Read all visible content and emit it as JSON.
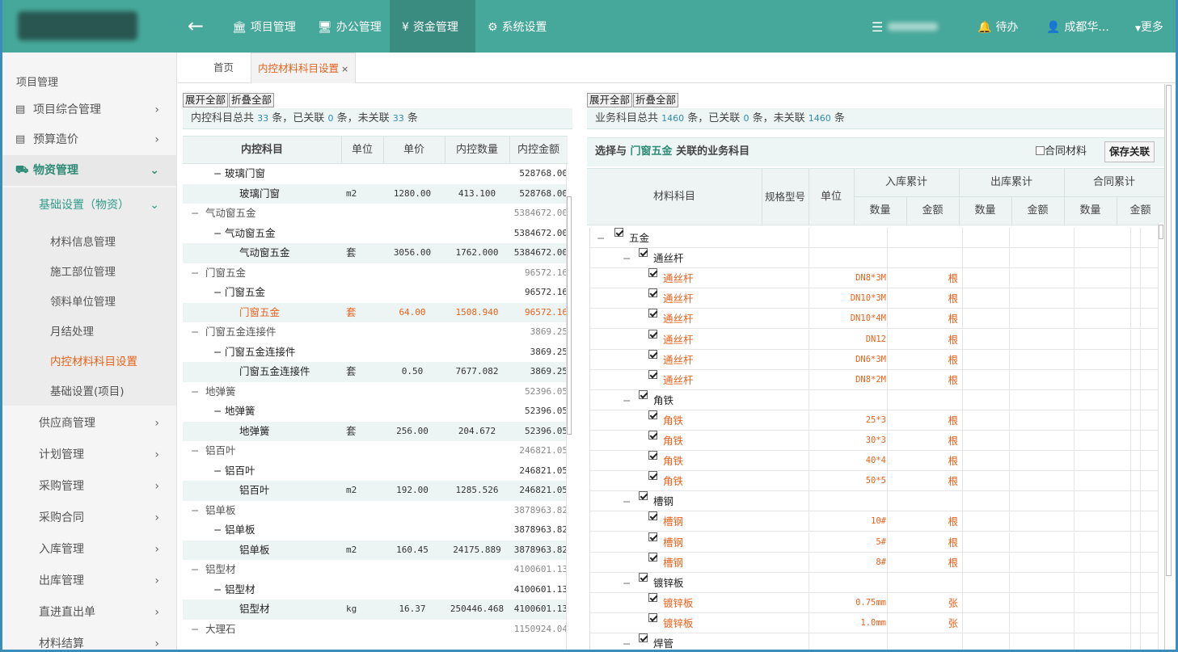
{
  "nav": {
    "back_icon": "arrow-left-icon",
    "project": "项目管理",
    "office": "办公管理",
    "finance": "资金管理",
    "finance_icon": "¥",
    "settings": "系统设置",
    "todo": "待办",
    "user": "成都华...",
    "more": "更多"
  },
  "sidebar": {
    "title": "项目管理",
    "items": [
      {
        "label": "项目综合管理"
      },
      {
        "label": "预算造价"
      },
      {
        "label": "物资管理"
      }
    ],
    "basic": "基础设置（物资）",
    "subitems": [
      "材料信息管理",
      "施工部位管理",
      "领料单位管理",
      "月结处理",
      "内控材料科目设置",
      "基础设置(项目)"
    ],
    "more_items": [
      "供应商管理",
      "计划管理",
      "采购管理",
      "采购合同",
      "入库管理",
      "出库管理",
      "直进直出单",
      "材料结算"
    ]
  },
  "tabs": {
    "home": "首页",
    "current": "内控材料科目设置",
    "close": "×"
  },
  "left": {
    "expand": "展开全部",
    "collapse": "折叠全部",
    "summary_a": "内控科目总共",
    "total": "33",
    "summary_b": "条，已关联",
    "linked": "0",
    "summary_c": "条，未关联",
    "unlinked": "33",
    "summary_d": "条",
    "headers": [
      "内控科目",
      "单位",
      "单价",
      "内控数量",
      "内控金额"
    ],
    "rows": [
      {
        "lvl": 2,
        "name": "玻璃门窗",
        "amount": "528768.00"
      },
      {
        "lvl": 3,
        "name": "玻璃门窗",
        "unit": "m2",
        "price": "1280.00",
        "qty": "413.100",
        "amount": "528768.00"
      },
      {
        "lvl": 1,
        "name": "气动窗五金",
        "amount": "5384672.00"
      },
      {
        "lvl": 2,
        "name": "气动窗五金",
        "amount": "5384672.00"
      },
      {
        "lvl": 3,
        "name": "气动窗五金",
        "unit": "套",
        "price": "3056.00",
        "qty": "1762.000",
        "amount": "5384672.00"
      },
      {
        "lvl": 1,
        "name": "门窗五金",
        "amount": "96572.16"
      },
      {
        "lvl": 2,
        "name": "门窗五金",
        "amount": "96572.16"
      },
      {
        "lvl": 3,
        "name": "门窗五金",
        "unit": "套",
        "price": "64.00",
        "qty": "1508.940",
        "amount": "96572.16",
        "selected": true
      },
      {
        "lvl": 1,
        "name": "门窗五金连接件",
        "amount": "3869.25"
      },
      {
        "lvl": 2,
        "name": "门窗五金连接件",
        "amount": "3869.25"
      },
      {
        "lvl": 3,
        "name": "门窗五金连接件",
        "unit": "套",
        "price": "0.50",
        "qty": "7677.082",
        "amount": "3869.25"
      },
      {
        "lvl": 1,
        "name": "地弹簧",
        "amount": "52396.05"
      },
      {
        "lvl": 2,
        "name": "地弹簧",
        "amount": "52396.05"
      },
      {
        "lvl": 3,
        "name": "地弹簧",
        "unit": "套",
        "price": "256.00",
        "qty": "204.672",
        "amount": "52396.05"
      },
      {
        "lvl": 1,
        "name": "铝百叶",
        "amount": "246821.05"
      },
      {
        "lvl": 2,
        "name": "铝百叶",
        "amount": "246821.05"
      },
      {
        "lvl": 3,
        "name": "铝百叶",
        "unit": "m2",
        "price": "192.00",
        "qty": "1285.526",
        "amount": "246821.05"
      },
      {
        "lvl": 1,
        "name": "铝单板",
        "amount": "3878963.82"
      },
      {
        "lvl": 2,
        "name": "铝单板",
        "amount": "3878963.82"
      },
      {
        "lvl": 3,
        "name": "铝单板",
        "unit": "m2",
        "price": "160.45",
        "qty": "24175.889",
        "amount": "3878963.82"
      },
      {
        "lvl": 1,
        "name": "铝型材",
        "amount": "4100601.13"
      },
      {
        "lvl": 2,
        "name": "铝型材",
        "amount": "4100601.13"
      },
      {
        "lvl": 3,
        "name": "铝型材",
        "unit": "kg",
        "price": "16.37",
        "qty": "250446.468",
        "amount": "4100601.13"
      },
      {
        "lvl": 1,
        "name": "大理石",
        "amount": "1150924.04"
      }
    ]
  },
  "right": {
    "expand": "展开全部",
    "collapse": "折叠全部",
    "summary_a": "业务科目总共",
    "total": "1460",
    "summary_b": "条，已关联",
    "linked": "0",
    "summary_c": "条，未关联",
    "unlinked": "1460",
    "summary_d": "条",
    "title_a": "选择与",
    "title_subject": "门窗五金",
    "title_b": "关联的业务科目",
    "contract_label": "合同材料",
    "save": "保存关联",
    "headers": {
      "material": "材料科目",
      "spec": "规格型号",
      "unit": "单位",
      "in": "入库累计",
      "out": "出库累计",
      "contract": "合同累计",
      "qty": "数量",
      "amount": "金额"
    },
    "rows": [
      {
        "lvl": 1,
        "name": "五金"
      },
      {
        "lvl": 2,
        "name": "通丝杆"
      },
      {
        "lvl": 3,
        "name": "通丝杆",
        "spec": "DN8*3M",
        "unit": "根"
      },
      {
        "lvl": 3,
        "name": "通丝杆",
        "spec": "DN10*3M",
        "unit": "根"
      },
      {
        "lvl": 3,
        "name": "通丝杆",
        "spec": "DN10*4M",
        "unit": "根"
      },
      {
        "lvl": 3,
        "name": "通丝杆",
        "spec": "DN12",
        "unit": "根"
      },
      {
        "lvl": 3,
        "name": "通丝杆",
        "spec": "DN6*3M",
        "unit": "根"
      },
      {
        "lvl": 3,
        "name": "通丝杆",
        "spec": "DN8*2M",
        "unit": "根"
      },
      {
        "lvl": 2,
        "name": "角铁"
      },
      {
        "lvl": 3,
        "name": "角铁",
        "spec": "25*3",
        "unit": "根"
      },
      {
        "lvl": 3,
        "name": "角铁",
        "spec": "30*3",
        "unit": "根"
      },
      {
        "lvl": 3,
        "name": "角铁",
        "spec": "40*4",
        "unit": "根"
      },
      {
        "lvl": 3,
        "name": "角铁",
        "spec": "50*5",
        "unit": "根"
      },
      {
        "lvl": 2,
        "name": "槽钢"
      },
      {
        "lvl": 3,
        "name": "槽钢",
        "spec": "10#",
        "unit": "根"
      },
      {
        "lvl": 3,
        "name": "槽钢",
        "spec": "5#",
        "unit": "根"
      },
      {
        "lvl": 3,
        "name": "槽钢",
        "spec": "8#",
        "unit": "根"
      },
      {
        "lvl": 2,
        "name": "镀锌板"
      },
      {
        "lvl": 3,
        "name": "镀锌板",
        "spec": "0.75mm",
        "unit": "张"
      },
      {
        "lvl": 3,
        "name": "镀锌板",
        "spec": "1.0mm",
        "unit": "张"
      },
      {
        "lvl": 2,
        "name": "焊管"
      }
    ]
  }
}
